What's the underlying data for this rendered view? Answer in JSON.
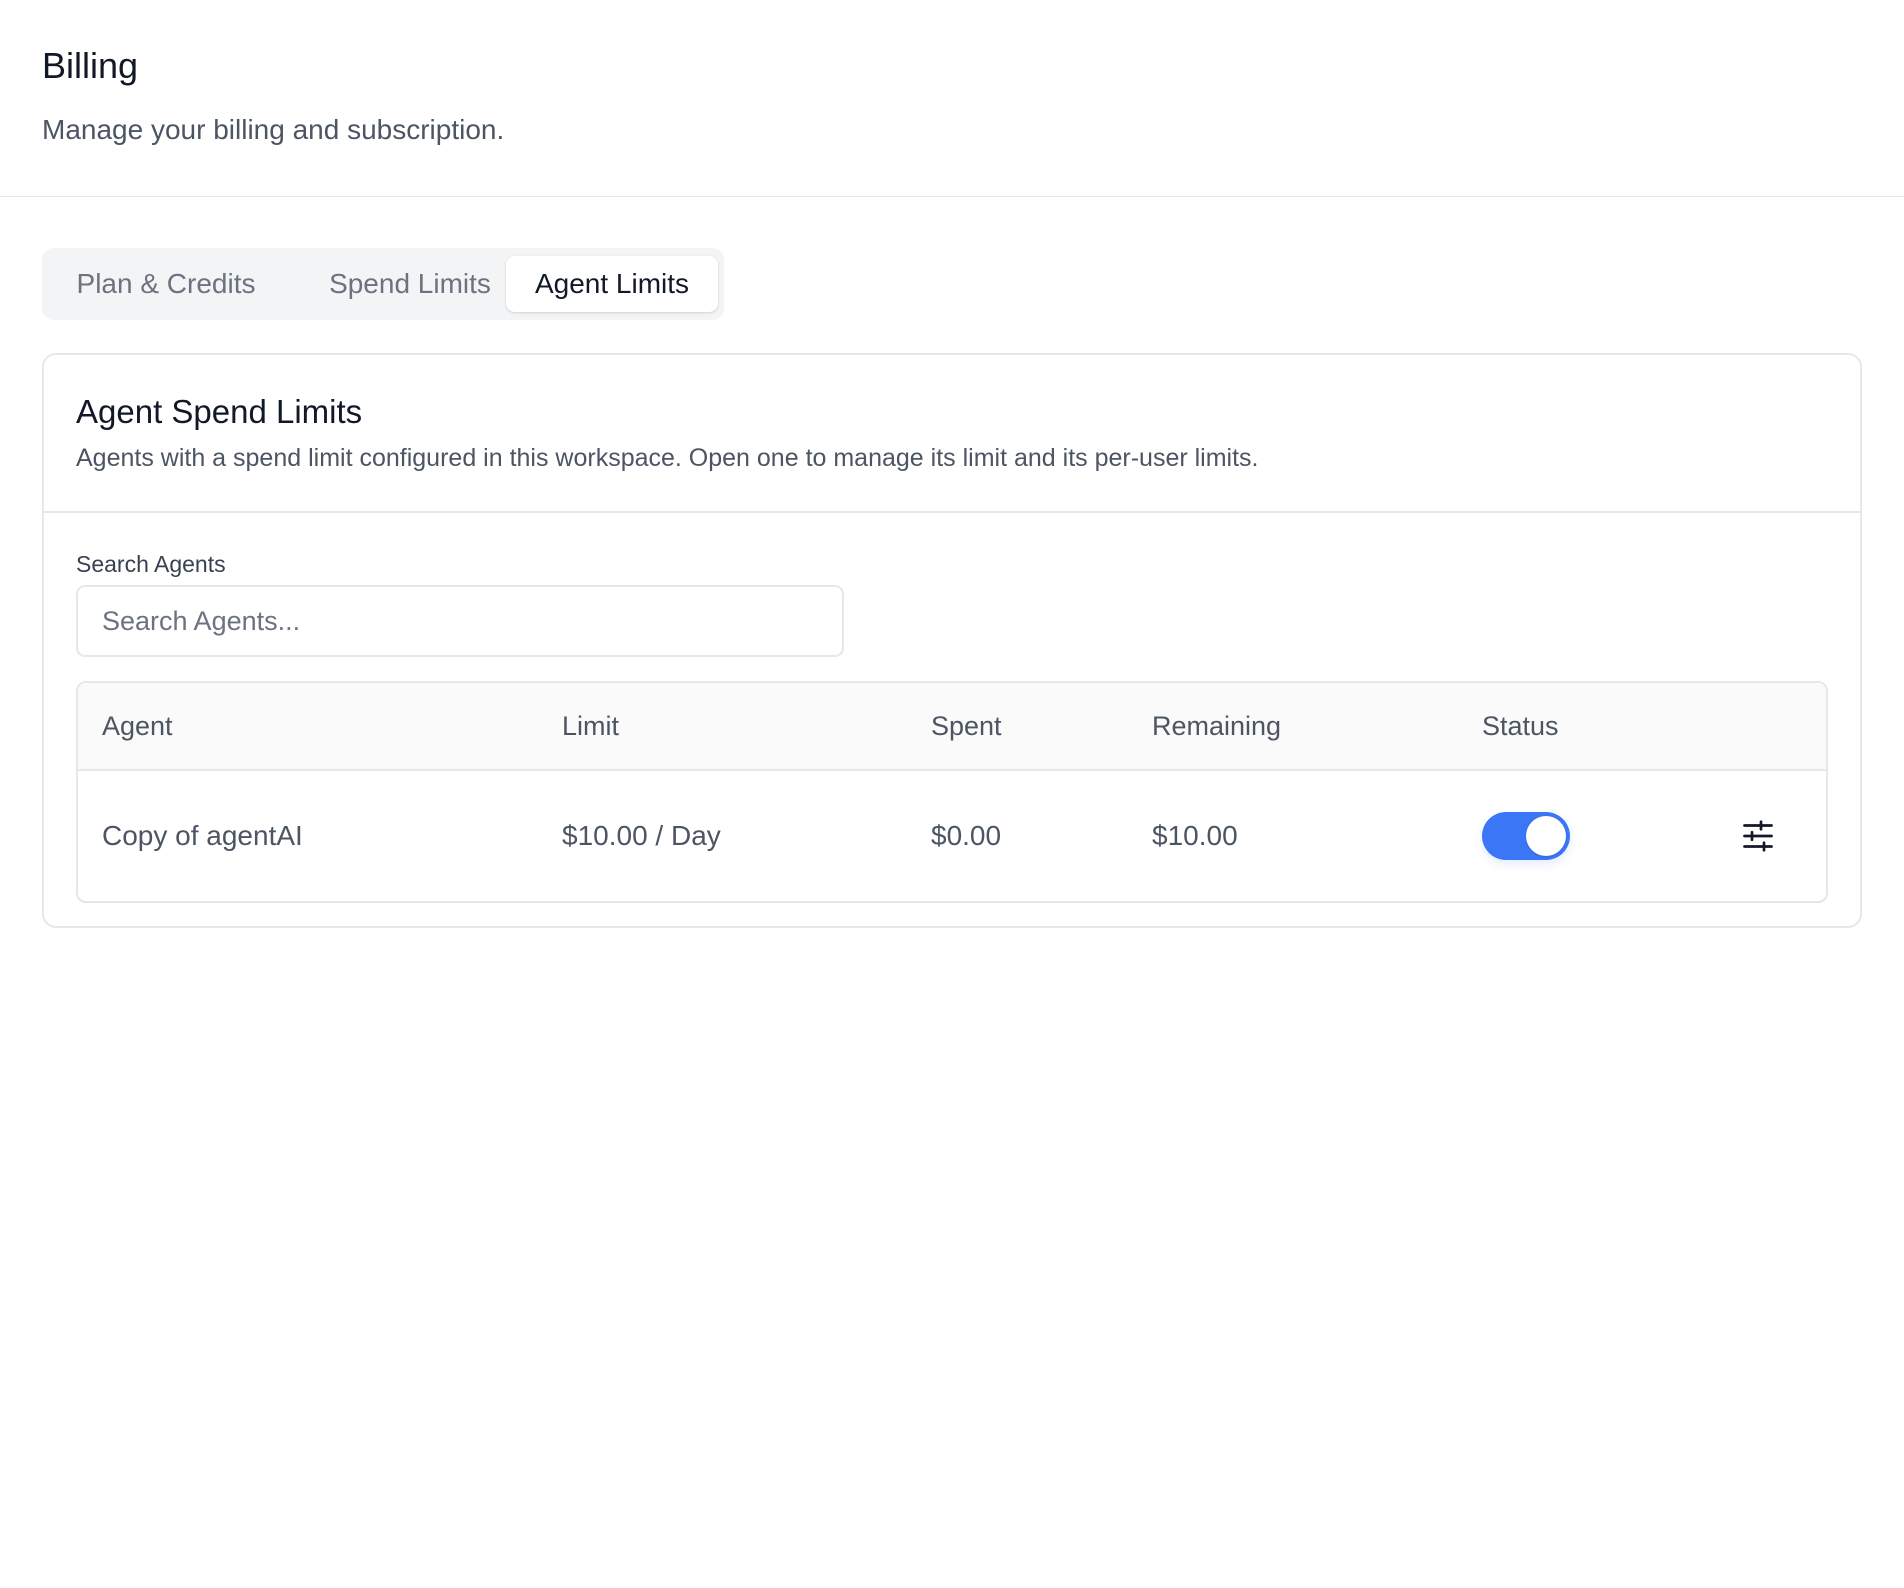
{
  "header": {
    "title": "Billing",
    "subtitle": "Manage your billing and subscription."
  },
  "tabs": [
    {
      "label": "Plan & Credits",
      "active": false
    },
    {
      "label": "Spend Limits",
      "active": false
    },
    {
      "label": "Agent Limits",
      "active": true
    }
  ],
  "card": {
    "title": "Agent Spend Limits",
    "description": "Agents with a spend limit configured in this workspace. Open one to manage its limit and its per-user limits."
  },
  "search": {
    "label": "Search Agents",
    "placeholder": "Search Agents...",
    "value": ""
  },
  "table": {
    "columns": [
      "Agent",
      "Limit",
      "Spent",
      "Remaining",
      "Status"
    ],
    "rows": [
      {
        "agent": "Copy of agentAI",
        "limit": "$10.00 / Day",
        "spent": "$0.00",
        "remaining": "$10.00",
        "status_enabled": true,
        "action_icon": "sliders-icon"
      }
    ]
  },
  "colors": {
    "accent": "#3b76f6",
    "border": "#e5e7eb",
    "muted_text": "#4b5563"
  }
}
